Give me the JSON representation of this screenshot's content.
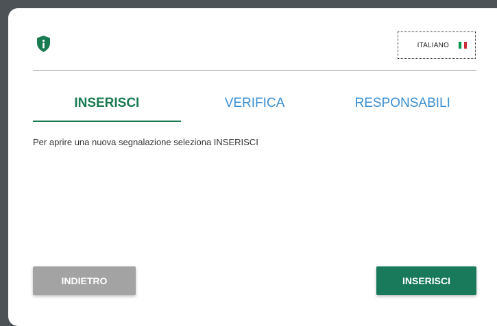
{
  "header": {
    "language": "ITALIANO",
    "flag_colors": [
      "#009246",
      "#ffffff",
      "#ce2b37"
    ],
    "shield_color": "#187a50"
  },
  "tabs": [
    {
      "label": "INSERISCI",
      "active": true
    },
    {
      "label": "VERIFICA",
      "active": false
    },
    {
      "label": "RESPONSABILI",
      "active": false
    }
  ],
  "main": {
    "instruction": "Per aprire una nuova segnalazione seleziona INSERISCI"
  },
  "footer": {
    "back_label": "INDIETRO",
    "insert_label": "INSERISCI"
  },
  "colors": {
    "accent": "#187a50",
    "link": "#3a8fd4",
    "disabled": "#a3a3a3"
  }
}
